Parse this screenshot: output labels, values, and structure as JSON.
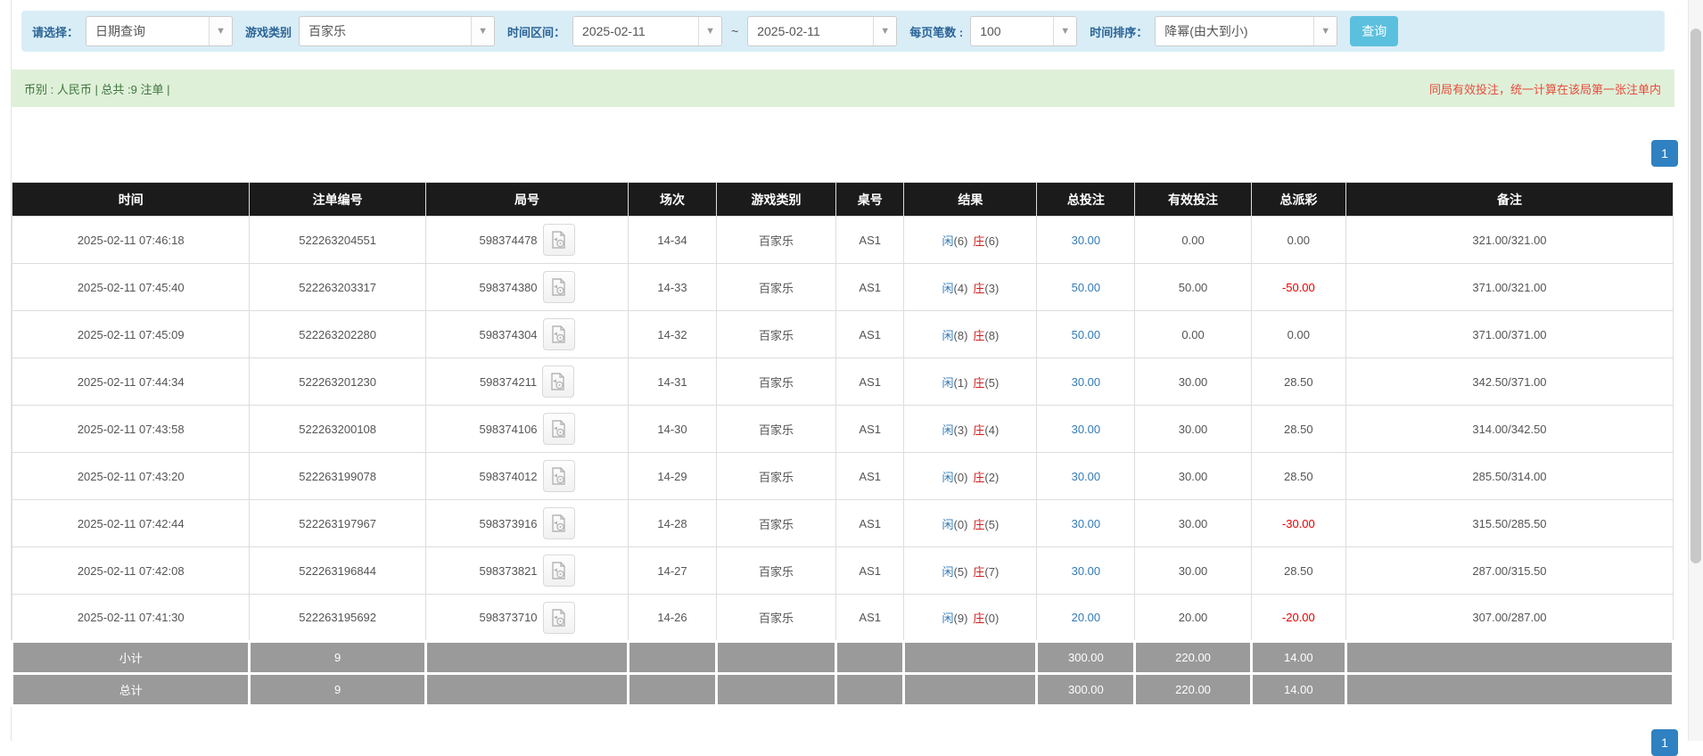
{
  "filter_bar": {
    "type_label": "请选择：",
    "type_value": "日期查询",
    "game_label": "游戏类别",
    "game_value": "百家乐",
    "range_label": "时间区间：",
    "date_from": "2025-02-11",
    "tilde": "~",
    "date_to": "2025-02-11",
    "page_size_label": "每页笔数 :",
    "page_size_value": "100",
    "sort_label": "时间排序：",
    "sort_value": "降幂(由大到小)",
    "search_button": "查询"
  },
  "summary_bar": {
    "left_text": "币别 : 人民币 | 总共 :9 注单 |",
    "right_notice": "同局有效投注，统一计算在该局第一张注单内"
  },
  "pagination": {
    "page": "1"
  },
  "icons": {
    "dropdown_arrow": "▼",
    "round_replay_icon": "video-document"
  },
  "colors": {
    "filter_bg": "#d9edf7",
    "summary_bg": "#dff0d8",
    "header_bg": "#1b1b1b",
    "accent_blue": "#337ab7",
    "banker_red": "#cc2222",
    "negative_red": "#e60000",
    "notice_red": "#e74c3c",
    "totals_gray": "#9a9a9a",
    "pager_blue": "#2f81c1",
    "search_btn": "#5bc0de"
  },
  "table": {
    "headers": [
      "时间",
      "注单编号",
      "局号",
      "场次",
      "游戏类别",
      "桌号",
      "结果",
      "总投注",
      "有效投注",
      "总派彩",
      "备注"
    ],
    "result_labels": {
      "player": "闲",
      "banker": "庄"
    },
    "rows": [
      {
        "time": "2025-02-11 07:46:18",
        "bet_id": "522263204551",
        "round": "598374478",
        "session": "14-34",
        "game": "百家乐",
        "table_no": "AS1",
        "player_points": "(6)",
        "banker_points": "(6)",
        "total_bet": "30.00",
        "valid_bet": "0.00",
        "payout": "0.00",
        "remark": "321.00/321.00"
      },
      {
        "time": "2025-02-11 07:45:40",
        "bet_id": "522263203317",
        "round": "598374380",
        "session": "14-33",
        "game": "百家乐",
        "table_no": "AS1",
        "player_points": "(4)",
        "banker_points": "(3)",
        "total_bet": "50.00",
        "valid_bet": "50.00",
        "payout": "-50.00",
        "remark": "371.00/321.00"
      },
      {
        "time": "2025-02-11 07:45:09",
        "bet_id": "522263202280",
        "round": "598374304",
        "session": "14-32",
        "game": "百家乐",
        "table_no": "AS1",
        "player_points": "(8)",
        "banker_points": "(8)",
        "total_bet": "50.00",
        "valid_bet": "0.00",
        "payout": "0.00",
        "remark": "371.00/371.00"
      },
      {
        "time": "2025-02-11 07:44:34",
        "bet_id": "522263201230",
        "round": "598374211",
        "session": "14-31",
        "game": "百家乐",
        "table_no": "AS1",
        "player_points": "(1)",
        "banker_points": "(5)",
        "total_bet": "30.00",
        "valid_bet": "30.00",
        "payout": "28.50",
        "remark": "342.50/371.00"
      },
      {
        "time": "2025-02-11 07:43:58",
        "bet_id": "522263200108",
        "round": "598374106",
        "session": "14-30",
        "game": "百家乐",
        "table_no": "AS1",
        "player_points": "(3)",
        "banker_points": "(4)",
        "total_bet": "30.00",
        "valid_bet": "30.00",
        "payout": "28.50",
        "remark": "314.00/342.50"
      },
      {
        "time": "2025-02-11 07:43:20",
        "bet_id": "522263199078",
        "round": "598374012",
        "session": "14-29",
        "game": "百家乐",
        "table_no": "AS1",
        "player_points": "(0)",
        "banker_points": "(2)",
        "total_bet": "30.00",
        "valid_bet": "30.00",
        "payout": "28.50",
        "remark": "285.50/314.00"
      },
      {
        "time": "2025-02-11 07:42:44",
        "bet_id": "522263197967",
        "round": "598373916",
        "session": "14-28",
        "game": "百家乐",
        "table_no": "AS1",
        "player_points": "(0)",
        "banker_points": "(5)",
        "total_bet": "30.00",
        "valid_bet": "30.00",
        "payout": "-30.00",
        "remark": "315.50/285.50"
      },
      {
        "time": "2025-02-11 07:42:08",
        "bet_id": "522263196844",
        "round": "598373821",
        "session": "14-27",
        "game": "百家乐",
        "table_no": "AS1",
        "player_points": "(5)",
        "banker_points": "(7)",
        "total_bet": "30.00",
        "valid_bet": "30.00",
        "payout": "28.50",
        "remark": "287.00/315.50"
      },
      {
        "time": "2025-02-11 07:41:30",
        "bet_id": "522263195692",
        "round": "598373710",
        "session": "14-26",
        "game": "百家乐",
        "table_no": "AS1",
        "player_points": "(9)",
        "banker_points": "(0)",
        "total_bet": "20.00",
        "valid_bet": "20.00",
        "payout": "-20.00",
        "remark": "307.00/287.00"
      }
    ],
    "subtotal": {
      "label": "小计",
      "count": "9",
      "total_bet": "300.00",
      "valid_bet": "220.00",
      "payout": "14.00"
    },
    "total": {
      "label": "总计",
      "count": "9",
      "total_bet": "300.00",
      "valid_bet": "220.00",
      "payout": "14.00"
    }
  }
}
